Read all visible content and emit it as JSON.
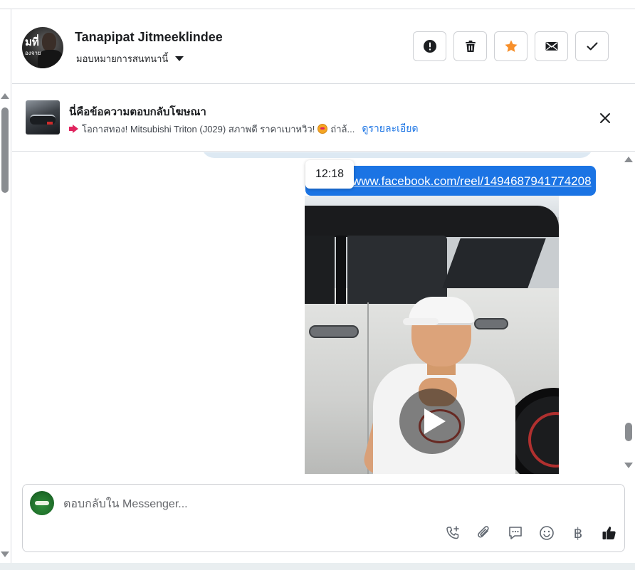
{
  "header": {
    "contact_name": "Tanapipat Jitmeeklindee",
    "assign_label": "มอบหมายการสนทนานี้",
    "avatar_text": "มที่",
    "avatar_subtext": "องจาย",
    "actions": [
      {
        "name": "spam-button",
        "icon": "alert-circle-icon"
      },
      {
        "name": "delete-button",
        "icon": "trash-icon"
      },
      {
        "name": "star-button",
        "icon": "star-icon",
        "color": "#f78f2a"
      },
      {
        "name": "mark-unread-button",
        "icon": "envelope-icon"
      },
      {
        "name": "mark-done-button",
        "icon": "check-icon"
      }
    ]
  },
  "ad_banner": {
    "title": "นี่คือข้อความตอบกลับโฆษณา",
    "subtitle": "โอกาสทอง! Mitsubishi Triton (J029) สภาพดี ราคาเบาหวิว!",
    "subtitle_trail": "ถ่าล้...",
    "link_label": "ดูรายละเอียด",
    "link_color": "#1b74e4"
  },
  "messages": {
    "timestamp_tooltip": "12:18",
    "link_text": "www.facebook.com/reel/1494687941774208",
    "bubble_color": "#1b74e4",
    "video_thumbnail_icon": "play-icon"
  },
  "composer": {
    "placeholder": "ตอบกลับใน Messenger...",
    "tools": [
      "add-call-icon",
      "attachment-icon",
      "saved-reply-icon",
      "emoji-icon",
      "payment-icon",
      "like-icon"
    ],
    "baht_symbol": "฿"
  }
}
